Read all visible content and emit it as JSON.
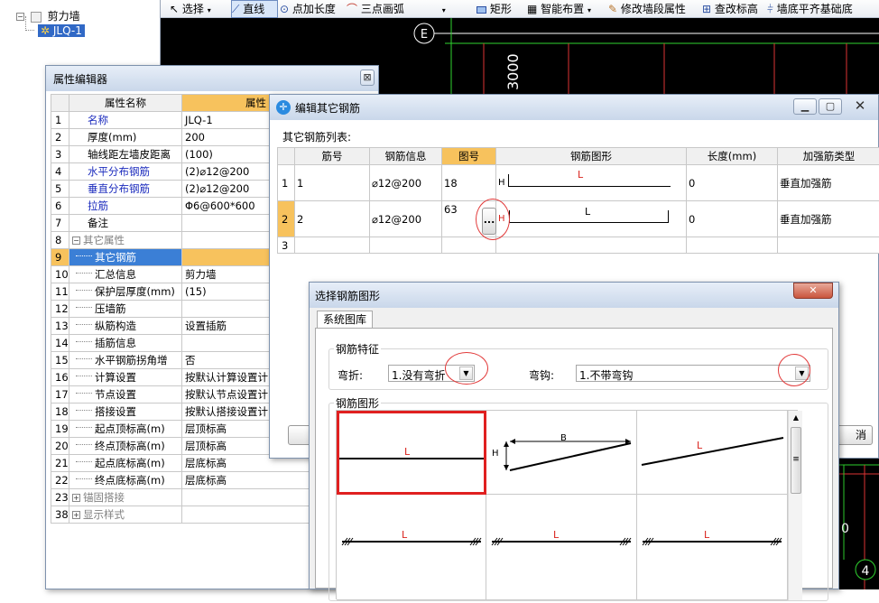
{
  "tree": {
    "root_label": "剪力墙",
    "child_label": "JLQ-1"
  },
  "toolbar": {
    "select": "选择",
    "line": "直线",
    "point_length": "点加长度",
    "arc": "三点画弧",
    "rect": "矩形",
    "smart_layout": "智能布置",
    "modify_segment": "修改墙段属性",
    "check_elevation": "查改标高",
    "wall_bottom": "墙底平齐基础底"
  },
  "cad": {
    "axis_e": "E",
    "axis_4": "4",
    "dim_3000": "3000",
    "dim_0": "0"
  },
  "property_editor": {
    "title": "属性编辑器",
    "header_name": "属性名称",
    "header_value": "属性",
    "rows": [
      {
        "num": "1",
        "name": "名称",
        "value": "JLQ-1",
        "style": "blue"
      },
      {
        "num": "2",
        "name": "厚度(mm)",
        "value": "200",
        "style": "normal"
      },
      {
        "num": "3",
        "name": "轴线距左墙皮距离",
        "value": "(100)",
        "style": "normal"
      },
      {
        "num": "4",
        "name": "水平分布钢筋",
        "value": "(2)⌀12@200",
        "style": "blue"
      },
      {
        "num": "5",
        "name": "垂直分布钢筋",
        "value": "(2)⌀12@200",
        "style": "blue"
      },
      {
        "num": "6",
        "name": "拉筋",
        "value": "Φ6@600*600",
        "style": "blue"
      },
      {
        "num": "7",
        "name": "备注",
        "value": "",
        "style": "normal"
      },
      {
        "num": "8",
        "name": "其它属性",
        "value": "",
        "style": "group"
      },
      {
        "num": "9",
        "name": "其它钢筋",
        "value": "",
        "style": "selected"
      },
      {
        "num": "10",
        "name": "汇总信息",
        "value": "剪力墙",
        "style": "child"
      },
      {
        "num": "11",
        "name": "保护层厚度(mm)",
        "value": "(15)",
        "style": "child"
      },
      {
        "num": "12",
        "name": "压墙筋",
        "value": "",
        "style": "child"
      },
      {
        "num": "13",
        "name": "纵筋构造",
        "value": "设置插筋",
        "style": "child"
      },
      {
        "num": "14",
        "name": "插筋信息",
        "value": "",
        "style": "child"
      },
      {
        "num": "15",
        "name": "水平钢筋拐角增",
        "value": "否",
        "style": "child"
      },
      {
        "num": "16",
        "name": "计算设置",
        "value": "按默认计算设置计",
        "style": "child"
      },
      {
        "num": "17",
        "name": "节点设置",
        "value": "按默认节点设置计",
        "style": "child"
      },
      {
        "num": "18",
        "name": "搭接设置",
        "value": "按默认搭接设置计",
        "style": "child"
      },
      {
        "num": "19",
        "name": "起点顶标高(m)",
        "value": "层顶标高",
        "style": "child"
      },
      {
        "num": "20",
        "name": "终点顶标高(m)",
        "value": "层顶标高",
        "style": "child"
      },
      {
        "num": "21",
        "name": "起点底标高(m)",
        "value": "层底标高",
        "style": "child"
      },
      {
        "num": "22",
        "name": "终点底标高(m)",
        "value": "层底标高",
        "style": "child"
      },
      {
        "num": "23",
        "name": "锚固搭接",
        "value": "",
        "style": "group"
      },
      {
        "num": "38",
        "name": "显示样式",
        "value": "",
        "style": "group"
      }
    ]
  },
  "edit_dialog": {
    "title": "编辑其它钢筋",
    "list_label": "其它钢筋列表:",
    "columns": [
      "",
      "筋号",
      "钢筋信息",
      "图号",
      "钢筋图形",
      "长度(mm)",
      "加强筋类型"
    ],
    "rows": [
      {
        "idx": "1",
        "bar_no": "1",
        "info": "⌀12@200",
        "fig": "18",
        "shape_label": "L",
        "shape_h": "H",
        "length": "0",
        "type": "垂直加强筋"
      },
      {
        "idx": "2",
        "bar_no": "2",
        "info": "⌀12@200",
        "fig": "63",
        "shape_label": "L",
        "shape_h": "H",
        "length": "0",
        "type": "垂直加强筋"
      },
      {
        "idx": "3",
        "bar_no": "",
        "info": "",
        "fig": "",
        "shape_label": "",
        "shape_h": "",
        "length": "",
        "type": ""
      }
    ],
    "ellipsis": "...",
    "cancel_partial": "消"
  },
  "shape_dialog": {
    "title": "选择钢筋图形",
    "tab": "系统图库",
    "feature_group": "钢筋特征",
    "bend_label": "弯折:",
    "bend_value": "1.没有弯折",
    "hook_label": "弯钩:",
    "hook_value": "1.不带弯钩",
    "shapes_group": "钢筋图形",
    "shape_L": "L",
    "shape_B": "B",
    "shape_H": "H"
  }
}
